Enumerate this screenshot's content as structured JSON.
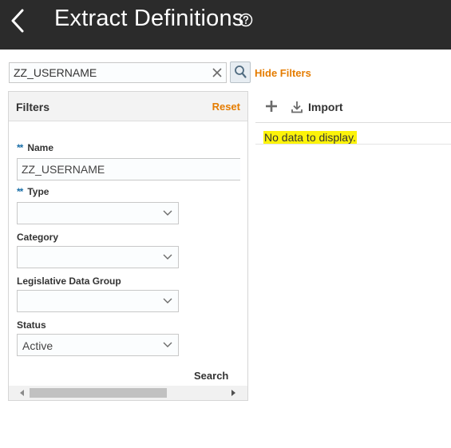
{
  "header": {
    "title": "Extract Definitions",
    "back_icon": "chevron-left-icon",
    "help_icon": "help-circle-icon"
  },
  "search": {
    "value": "ZZ_USERNAME",
    "clear_icon": "clear-icon",
    "search_icon": "search-icon",
    "hide_filters_label": "Hide Filters"
  },
  "filters": {
    "title": "Filters",
    "reset_label": "Reset",
    "required_marker": "**",
    "name": {
      "label": "Name",
      "value": "ZZ_USERNAME"
    },
    "type": {
      "label": "Type",
      "value": ""
    },
    "category": {
      "label": "Category",
      "value": ""
    },
    "ldg": {
      "label": "Legislative Data Group",
      "value": ""
    },
    "status": {
      "label": "Status",
      "value": "Active"
    },
    "search_label": "Search"
  },
  "results": {
    "add_icon": "plus-icon",
    "import_label": "Import",
    "import_icon": "download-icon",
    "empty_message": "No data to display."
  },
  "colors": {
    "header_bg": "#2b2b2b",
    "link_accent": "#e57c00",
    "required_marker": "#1b6fa8",
    "highlight": "#fcf30a"
  }
}
